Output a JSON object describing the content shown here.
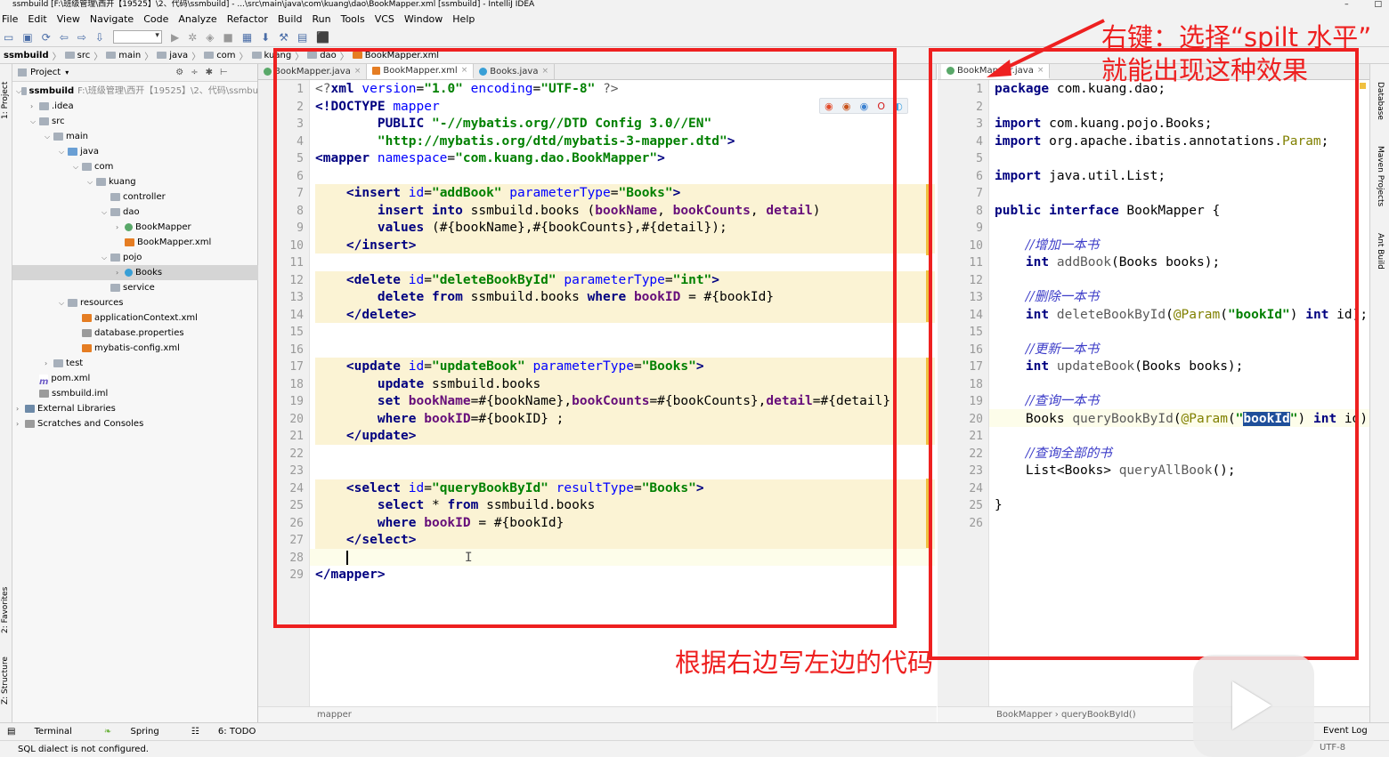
{
  "window": {
    "title": "ssmbuild [F:\\班级管理\\西开【19525】\\2、代码\\ssmbuild] - ...\\src\\main\\java\\com\\kuang\\dao\\BookMapper.xml [ssmbuild] - IntelliJ IDEA",
    "minimize": "–",
    "maximize": "□"
  },
  "menu": [
    "File",
    "Edit",
    "View",
    "Navigate",
    "Code",
    "Analyze",
    "Refactor",
    "Build",
    "Run",
    "Tools",
    "VCS",
    "Window",
    "Help"
  ],
  "breadcrumb": [
    "ssmbuild",
    "src",
    "main",
    "java",
    "com",
    "kuang",
    "dao",
    "BookMapper.xml"
  ],
  "project_panel": {
    "title": "Project",
    "tree": [
      {
        "label": "ssmbuild",
        "hint": "F:\\班级管理\\西开【19525】\\2、代码\\ssmbu",
        "icon": "folder",
        "depth": 0,
        "arrow": "v"
      },
      {
        "label": ".idea",
        "icon": "folder",
        "depth": 1,
        "arrow": ">"
      },
      {
        "label": "src",
        "icon": "folder",
        "depth": 1,
        "arrow": "v"
      },
      {
        "label": "main",
        "icon": "folder",
        "depth": 2,
        "arrow": "v"
      },
      {
        "label": "java",
        "icon": "src",
        "depth": 3,
        "arrow": "v"
      },
      {
        "label": "com",
        "icon": "folder",
        "depth": 4,
        "arrow": "v"
      },
      {
        "label": "kuang",
        "icon": "folder",
        "depth": 5,
        "arrow": "v"
      },
      {
        "label": "controller",
        "icon": "folder",
        "depth": 6,
        "arrow": ""
      },
      {
        "label": "dao",
        "icon": "folder",
        "depth": 6,
        "arrow": "v"
      },
      {
        "label": "BookMapper",
        "icon": "java",
        "depth": 7,
        "arrow": ">"
      },
      {
        "label": "BookMapper.xml",
        "icon": "xml",
        "depth": 7,
        "arrow": ""
      },
      {
        "label": "pojo",
        "icon": "folder",
        "depth": 6,
        "arrow": "v"
      },
      {
        "label": "Books",
        "icon": "class",
        "depth": 7,
        "arrow": ">",
        "selected": true
      },
      {
        "label": "service",
        "icon": "folder",
        "depth": 6,
        "arrow": ""
      },
      {
        "label": "resources",
        "icon": "folder",
        "depth": 3,
        "arrow": "v"
      },
      {
        "label": "applicationContext.xml",
        "icon": "xml",
        "depth": 4,
        "arrow": ""
      },
      {
        "label": "database.properties",
        "icon": "prop",
        "depth": 4,
        "arrow": ""
      },
      {
        "label": "mybatis-config.xml",
        "icon": "xml",
        "depth": 4,
        "arrow": ""
      },
      {
        "label": "test",
        "icon": "folder",
        "depth": 2,
        "arrow": ">"
      },
      {
        "label": "pom.xml",
        "icon": "mvn",
        "depth": 1,
        "arrow": ""
      },
      {
        "label": "ssmbuild.iml",
        "icon": "prop",
        "depth": 1,
        "arrow": ""
      },
      {
        "label": "External Libraries",
        "icon": "lib",
        "depth": 0,
        "arrow": ">"
      },
      {
        "label": "Scratches and Consoles",
        "icon": "prop",
        "depth": 0,
        "arrow": ">"
      }
    ]
  },
  "left_editor": {
    "tabs": [
      {
        "label": "BookMapper.java",
        "icon": "java",
        "active": false
      },
      {
        "label": "BookMapper.xml",
        "icon": "xml",
        "active": true
      },
      {
        "label": "Books.java",
        "icon": "class",
        "active": false
      }
    ],
    "line_numbers": [
      "1",
      "2",
      "3",
      "4",
      "5",
      "6",
      "7",
      "8",
      "9",
      "10",
      "11",
      "12",
      "13",
      "14",
      "15",
      "16",
      "17",
      "18",
      "19",
      "20",
      "21",
      "22",
      "23",
      "24",
      "25",
      "26",
      "27",
      "28",
      "29"
    ],
    "footer": "mapper"
  },
  "right_editor": {
    "tabs": [
      {
        "label": "BookMapper.java",
        "icon": "java",
        "active": true
      }
    ],
    "line_numbers": [
      "1",
      "2",
      "3",
      "4",
      "5",
      "6",
      "7",
      "8",
      "9",
      "10",
      "11",
      "12",
      "13",
      "14",
      "15",
      "16",
      "17",
      "18",
      "19",
      "20",
      "21",
      "22",
      "23",
      "24",
      "25",
      "26"
    ],
    "footer": "BookMapper  ›  queryBookById()"
  },
  "annotations": {
    "top_right_line1": "右键：选择“spilt 水平”",
    "top_right_line2": "就能出现这种效果",
    "bottom_center": "根据右边写左边的代码"
  },
  "side_tabs_left": [
    "1: Project",
    "2: Favorites",
    "Z: Structure"
  ],
  "side_tabs_right": [
    "Database",
    "Maven Projects",
    "Ant Build"
  ],
  "bottom_tools": [
    "Terminal",
    "Spring",
    "6: TODO"
  ],
  "event_log": "Event Log",
  "status_message": "SQL dialect is not configured.",
  "status_right": "UTF-8",
  "colors": {
    "annotation_red": "#ee2020",
    "xml_tag": "#000080",
    "string": "#008000",
    "comment": "#3c3cc8"
  }
}
